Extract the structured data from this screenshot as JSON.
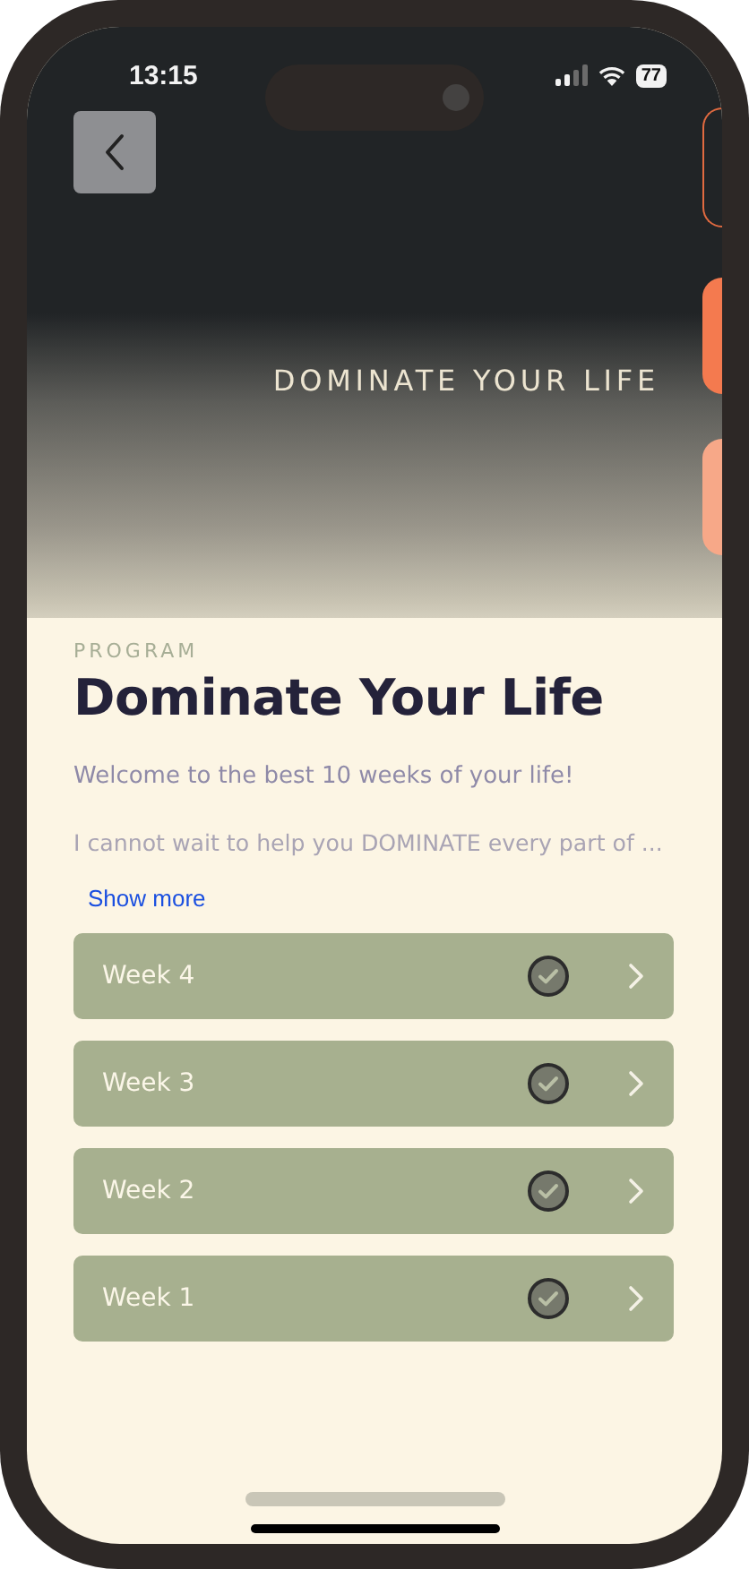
{
  "status_bar": {
    "time": "13:15",
    "battery": "77"
  },
  "hero": {
    "banner": "DOMINATE YOUR LIFE"
  },
  "program": {
    "label": "PROGRAM",
    "title": "Dominate Your Life",
    "description": [
      "Welcome to the best 10 weeks of your life!",
      "I cannot wait to help you DOMINATE every part of ..."
    ],
    "show_more": "Show more"
  },
  "weeks": [
    {
      "title": "Week 4",
      "completed": true
    },
    {
      "title": "Week 3",
      "completed": true
    },
    {
      "title": "Week 2",
      "completed": true
    },
    {
      "title": "Week 1",
      "completed": true
    }
  ]
}
